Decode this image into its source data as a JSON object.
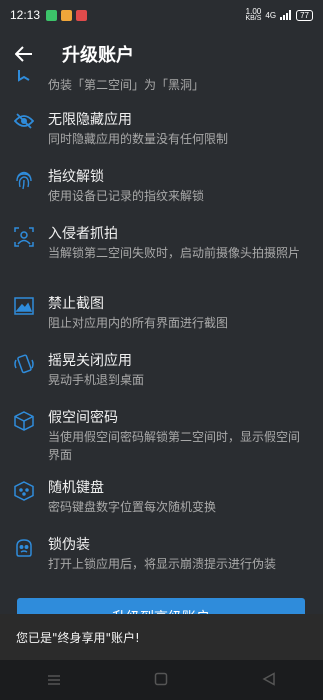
{
  "status": {
    "time": "12:13",
    "speed_value": "1.00",
    "speed_unit": "KB/S",
    "network": "4G",
    "battery": "77",
    "notif_colors": [
      "#3cc46a",
      "#f0a63a",
      "#e04b4b"
    ]
  },
  "app_bar": {
    "title": "升级账户"
  },
  "features": [
    {
      "icon": "mask-icon",
      "title": "",
      "desc": "伪装「第二空间」为「黑洞」"
    },
    {
      "icon": "eye-off-icon",
      "title": "无限隐藏应用",
      "desc": "同时隐藏应用的数量没有任何限制"
    },
    {
      "icon": "fingerprint-icon",
      "title": "指纹解锁",
      "desc": "使用设备已记录的指纹来解锁"
    },
    {
      "icon": "intruder-icon",
      "title": "入侵者抓拍",
      "desc": "当解锁第二空间失败时，启动前摄像头拍摄照片"
    },
    {
      "icon": "no-screenshot-icon",
      "title": "禁止截图",
      "desc": "阻止对应用内的所有界面进行截图"
    },
    {
      "icon": "shake-icon",
      "title": "摇晃关闭应用",
      "desc": "晃动手机退到桌面"
    },
    {
      "icon": "cube-icon",
      "title": "假空间密码",
      "desc": "当使用假空间密码解锁第二空间时，显示假空间界面"
    },
    {
      "icon": "random-keyboard-icon",
      "title": "随机键盘",
      "desc": "密码键盘数字位置每次随机变换"
    },
    {
      "icon": "lock-disguise-icon",
      "title": "锁伪装",
      "desc": "打开上锁应用后，将显示崩溃提示进行伪装"
    }
  ],
  "upgrade_button": "升级到高级账户",
  "snackbar": "您已是\"终身享用\"账户!",
  "colors": {
    "accent": "#2f8cdb",
    "background": "#2a2d31"
  }
}
